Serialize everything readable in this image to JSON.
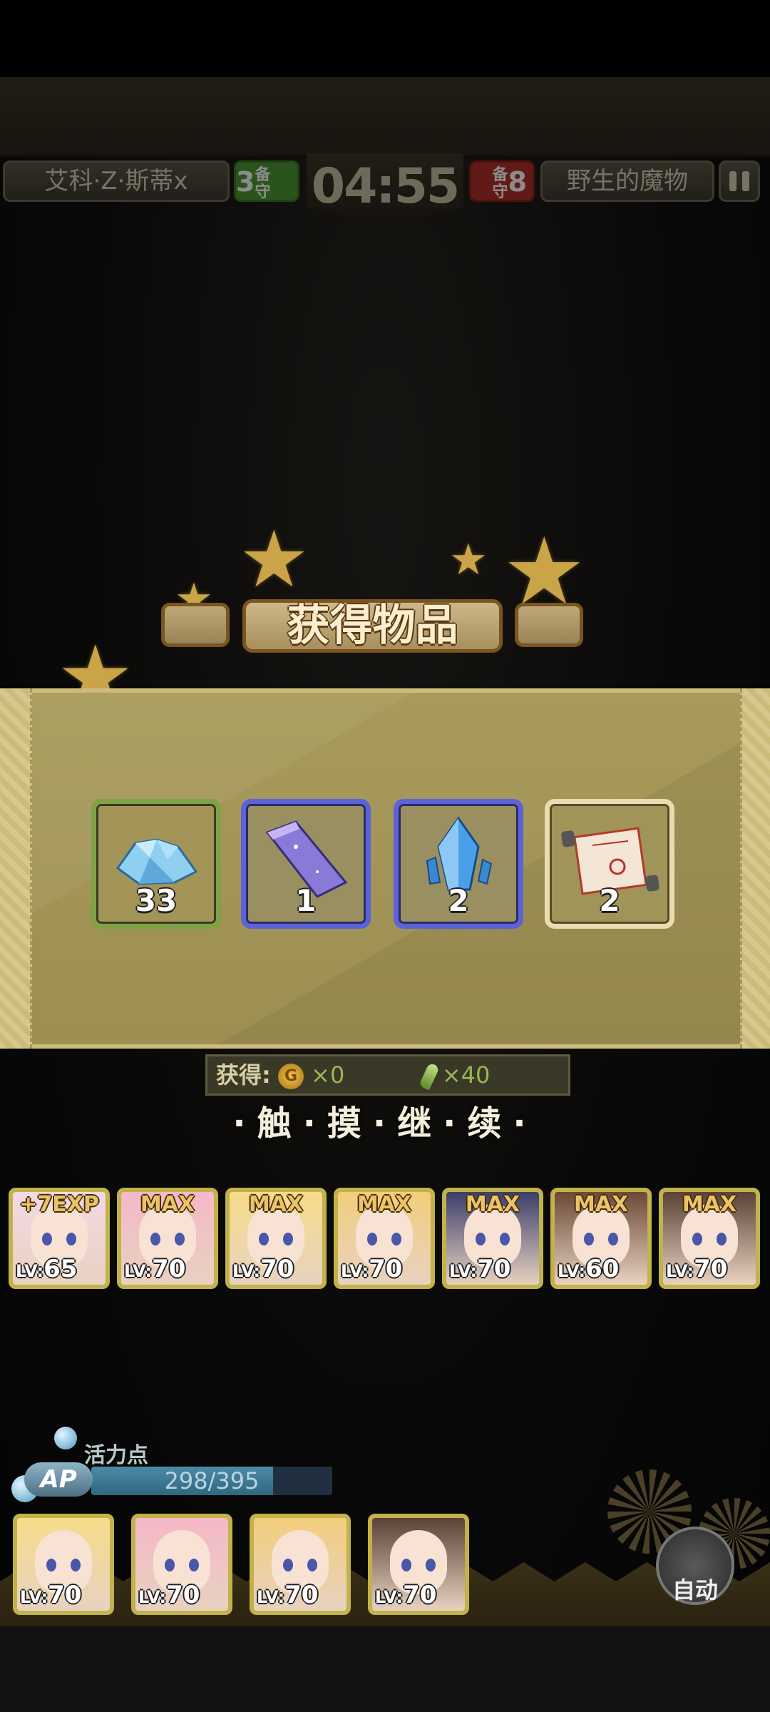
{
  "hud": {
    "player_name": "艾科·Z·斯蒂x",
    "player_guard_count": "3",
    "guard_label": "备守",
    "timer": "04:55",
    "enemy_guard_count": "8",
    "enemy_name": "野生的魔物"
  },
  "reward": {
    "title": "获得物品",
    "items": [
      {
        "icon": "crystal-pile-icon",
        "count": "33",
        "frame": "green"
      },
      {
        "icon": "purple-bar-icon",
        "count": "1",
        "frame": "blue"
      },
      {
        "icon": "blue-crystal-icon",
        "count": "2",
        "frame": "blue"
      },
      {
        "icon": "scroll-icon",
        "count": "2",
        "frame": "cream"
      }
    ],
    "gain_label": "获得:",
    "gold_icon_letter": "G",
    "gold_amount": "×0",
    "leaf_amount": "×40",
    "continue_text": "·触·摸·继·续·"
  },
  "party": [
    {
      "badge": "+7EXP",
      "lv_prefix": "LV:",
      "lv": "65",
      "hair": "#f2d9e6"
    },
    {
      "badge": "MAX",
      "lv_prefix": "LV:",
      "lv": "70",
      "hair": "#f5b8c8"
    },
    {
      "badge": "MAX",
      "lv_prefix": "LV:",
      "lv": "70",
      "hair": "#f6dc8a"
    },
    {
      "badge": "MAX",
      "lv_prefix": "LV:",
      "lv": "70",
      "hair": "#f2cd7c"
    },
    {
      "badge": "MAX",
      "lv_prefix": "LV:",
      "lv": "70",
      "hair": "#3c3e6a"
    },
    {
      "badge": "MAX",
      "lv_prefix": "LV:",
      "lv": "60",
      "hair": "#6b4a36"
    },
    {
      "badge": "MAX",
      "lv_prefix": "LV:",
      "lv": "70",
      "hair": "#5a4236"
    }
  ],
  "ap": {
    "label": "活力点",
    "icon_text": "AP",
    "current": 298,
    "max": 395,
    "text": "298/395"
  },
  "deck": [
    {
      "lv_prefix": "LV:",
      "lv": "70",
      "hair": "#f6dc8a"
    },
    {
      "lv_prefix": "LV:",
      "lv": "70",
      "hair": "#f5b8c8"
    },
    {
      "lv_prefix": "LV:",
      "lv": "70",
      "hair": "#f2cd7c"
    },
    {
      "lv_prefix": "LV:",
      "lv": "70",
      "hair": "#5a4236"
    }
  ],
  "auto_button_label": "自动",
  "colors": {
    "frame_gold": "#c2b24a",
    "frame_green": "#7fa246",
    "frame_blue": "#5b63d6",
    "frame_cream": "#e9dcb0",
    "player_badge": "#5aa03a",
    "enemy_badge": "#c0302a"
  }
}
